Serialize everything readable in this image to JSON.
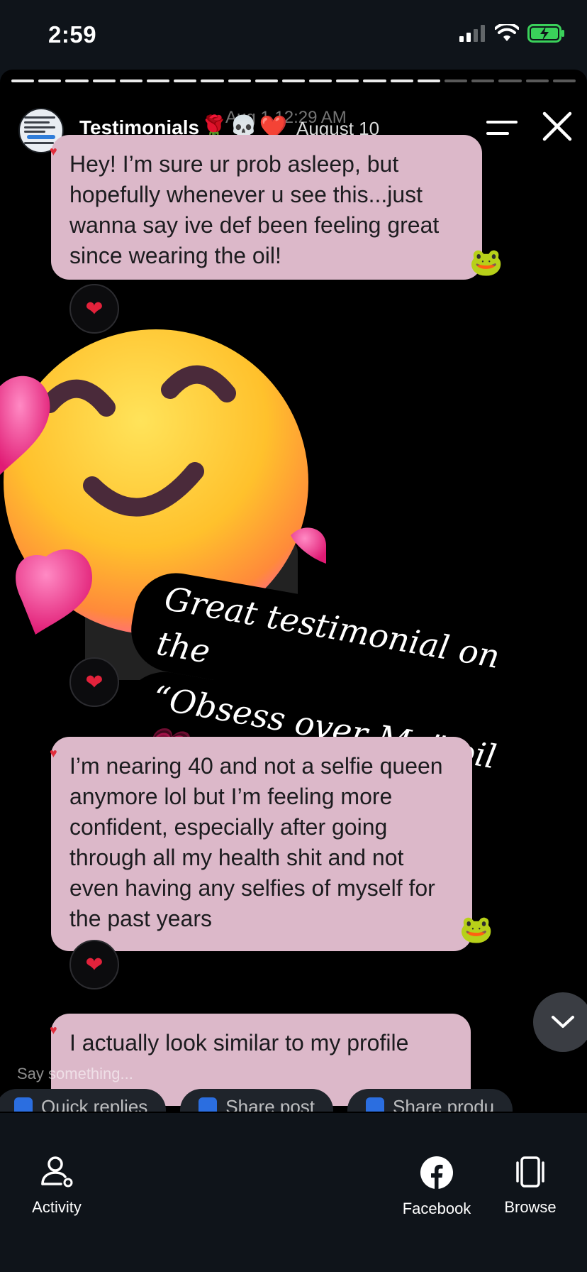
{
  "status_bar": {
    "time": "2:59"
  },
  "story": {
    "title": "Testimonials",
    "title_emojis": "🌹💀❤️",
    "timestamp": "Aug 1 12:29 AM",
    "date": "August 10"
  },
  "messages": [
    {
      "text": "Hey! I’m sure ur prob asleep, but hopefully whenever u see this...just wanna say ive def been feeling great since wearing the oil!",
      "reaction": "❤"
    },
    {
      "text": "I’m nearing 40 and not a selfie queen anymore lol but I’m feeling more confident, especially after going through all my health shit and not even having any selfies of myself for the past years",
      "reaction": "❤"
    },
    {
      "text": "I actually look similar to my profile"
    }
  ],
  "caption": {
    "line1": "Great testimonial on the",
    "line2": "“Obsess over Me” oil",
    "heart": "💗"
  },
  "composer": {
    "placeholder": "Say something..."
  },
  "quick_actions": [
    "Quick replies",
    "Share post",
    "Share produ"
  ],
  "bottom_nav": {
    "activity": "Activity",
    "facebook": "Facebook",
    "browse": "Browse"
  },
  "colors": {
    "bubble": "#dcb8c9",
    "background": "#000000",
    "heart": "#e3223b"
  }
}
